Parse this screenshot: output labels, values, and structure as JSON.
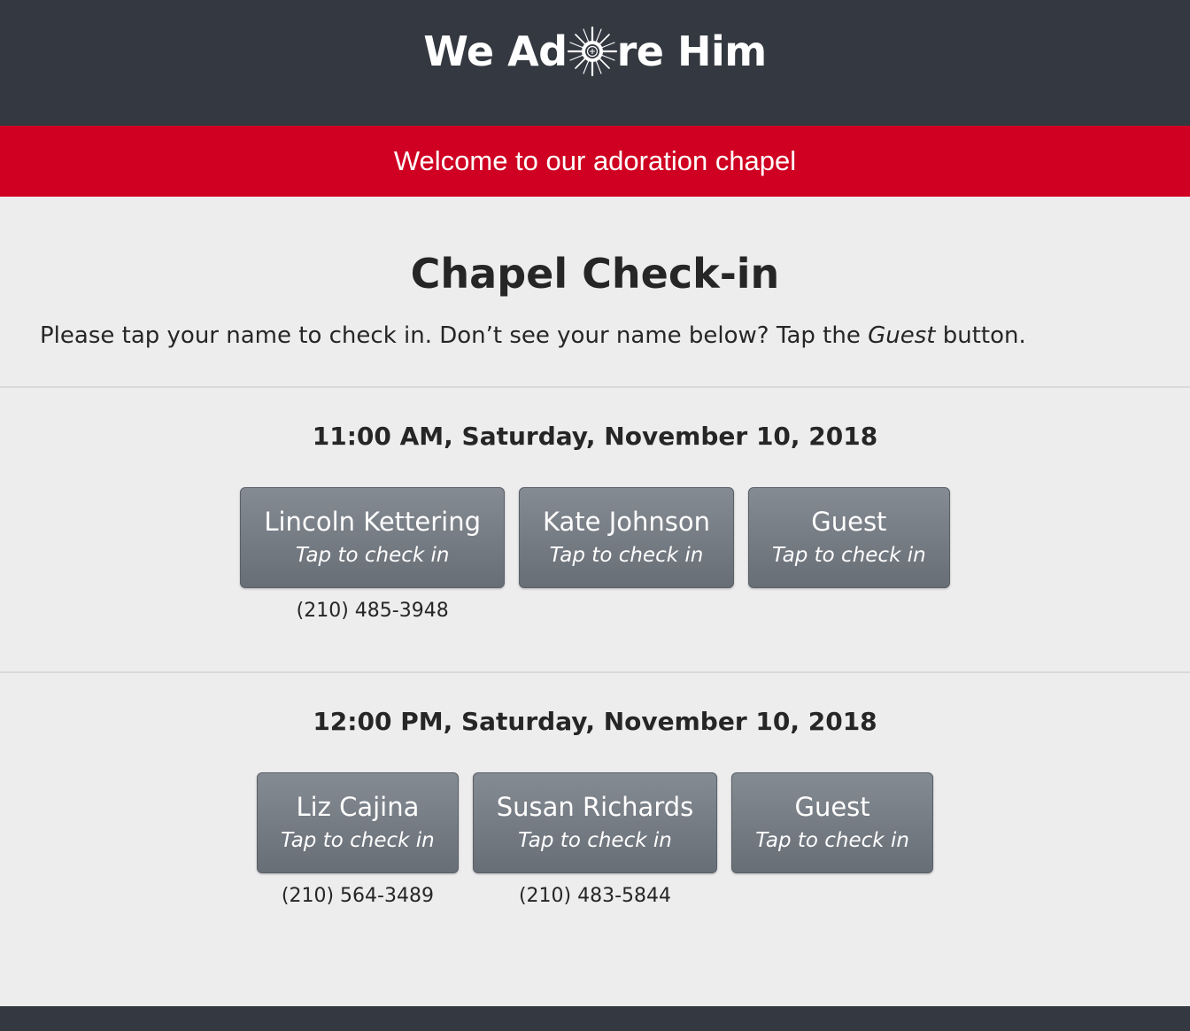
{
  "header": {
    "logo_text_before": "We Ad",
    "logo_text_after": "re Him",
    "logo_icon": "monstrance-icon",
    "background_color": "#343840"
  },
  "banner": {
    "text": "Welcome to our adoration chapel",
    "background_color": "#cf0021"
  },
  "page": {
    "title": "Chapel Check-in",
    "instruction_before": "Please tap your name to check in. Don’t see your name below? Tap the ",
    "instruction_emphasis": "Guest",
    "instruction_after": " button."
  },
  "slots": [
    {
      "time": "11:00 AM, Saturday, November 10, 2018",
      "people": [
        {
          "name": "Lincoln Kettering",
          "hint": "Tap to check in",
          "phone": "(210) 485-3948"
        },
        {
          "name": "Kate Johnson",
          "hint": "Tap to check in",
          "phone": ""
        },
        {
          "name": "Guest",
          "hint": "Tap to check in",
          "phone": ""
        }
      ]
    },
    {
      "time": "12:00 PM, Saturday, November 10, 2018",
      "people": [
        {
          "name": "Liz Cajina",
          "hint": "Tap to check in",
          "phone": "(210) 564-3489"
        },
        {
          "name": "Susan Richards",
          "hint": "Tap to check in",
          "phone": "(210) 483-5844"
        },
        {
          "name": "Guest",
          "hint": "Tap to check in",
          "phone": ""
        }
      ]
    }
  ]
}
